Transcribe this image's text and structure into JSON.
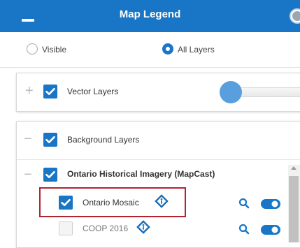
{
  "header": {
    "title": "Map Legend"
  },
  "visibility": {
    "options": [
      {
        "label": "Visible",
        "selected": false
      },
      {
        "label": "All Layers",
        "selected": true
      }
    ]
  },
  "groups": [
    {
      "label": "Vector Layers",
      "expand_symbol": "+",
      "checked": true,
      "opacity": 0.0
    },
    {
      "label": "Background Layers",
      "expand_symbol": "−",
      "checked": true,
      "children": [
        {
          "label": "Ontario Historical Imagery (MapCast)",
          "expand_symbol": "−",
          "checked": true,
          "children": [
            {
              "label": "Ontario Mosaic",
              "checked": true,
              "highlighted": true
            },
            {
              "label": "COOP 2016",
              "checked": false,
              "highlighted": false
            }
          ]
        }
      ]
    }
  ],
  "colors": {
    "primary": "#1976c7",
    "highlight": "#b2222f",
    "icon_blue": "#1976c7"
  },
  "icons": [
    "minus-icon",
    "close-icon",
    "plus-icon",
    "check-icon",
    "info-icon",
    "search-icon",
    "toggle-icon",
    "scroll-up-icon"
  ]
}
